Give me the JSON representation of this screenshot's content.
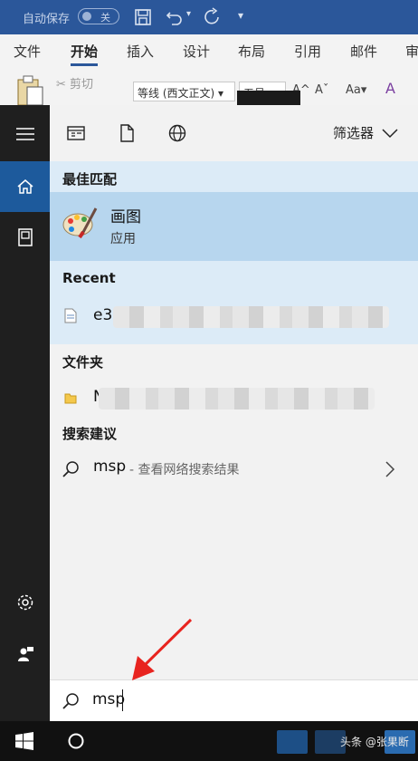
{
  "titlebar": {
    "autosave_label": "自动保存",
    "autosave_state": "关"
  },
  "ribbon_tabs": [
    "文件",
    "开始",
    "插入",
    "设计",
    "布局",
    "引用",
    "邮件",
    "审"
  ],
  "ribbon": {
    "cut_label": "剪切",
    "font_name": "等线 (西文正文)",
    "font_size": "五号"
  },
  "start_menu": {
    "filter_label": "筛选器",
    "best_match": {
      "title": "最佳匹配",
      "name": "画图",
      "type": "应用"
    },
    "recent": {
      "title": "Recent",
      "item_prefix": "e3"
    },
    "folders": {
      "title": "文件夹",
      "item_prefix": "N"
    },
    "suggestions": {
      "title": "搜索建议",
      "query": "msp",
      "desc": "- 查看网络搜索结果"
    },
    "search_value": "msp"
  },
  "taskbar": {
    "watermark": "头条 @张果断"
  },
  "colors": {
    "word_blue": "#2b579a",
    "rail_active": "#1d5a9c",
    "best_highlight": "#b7d6ee",
    "arrow_red": "#e8241f"
  }
}
